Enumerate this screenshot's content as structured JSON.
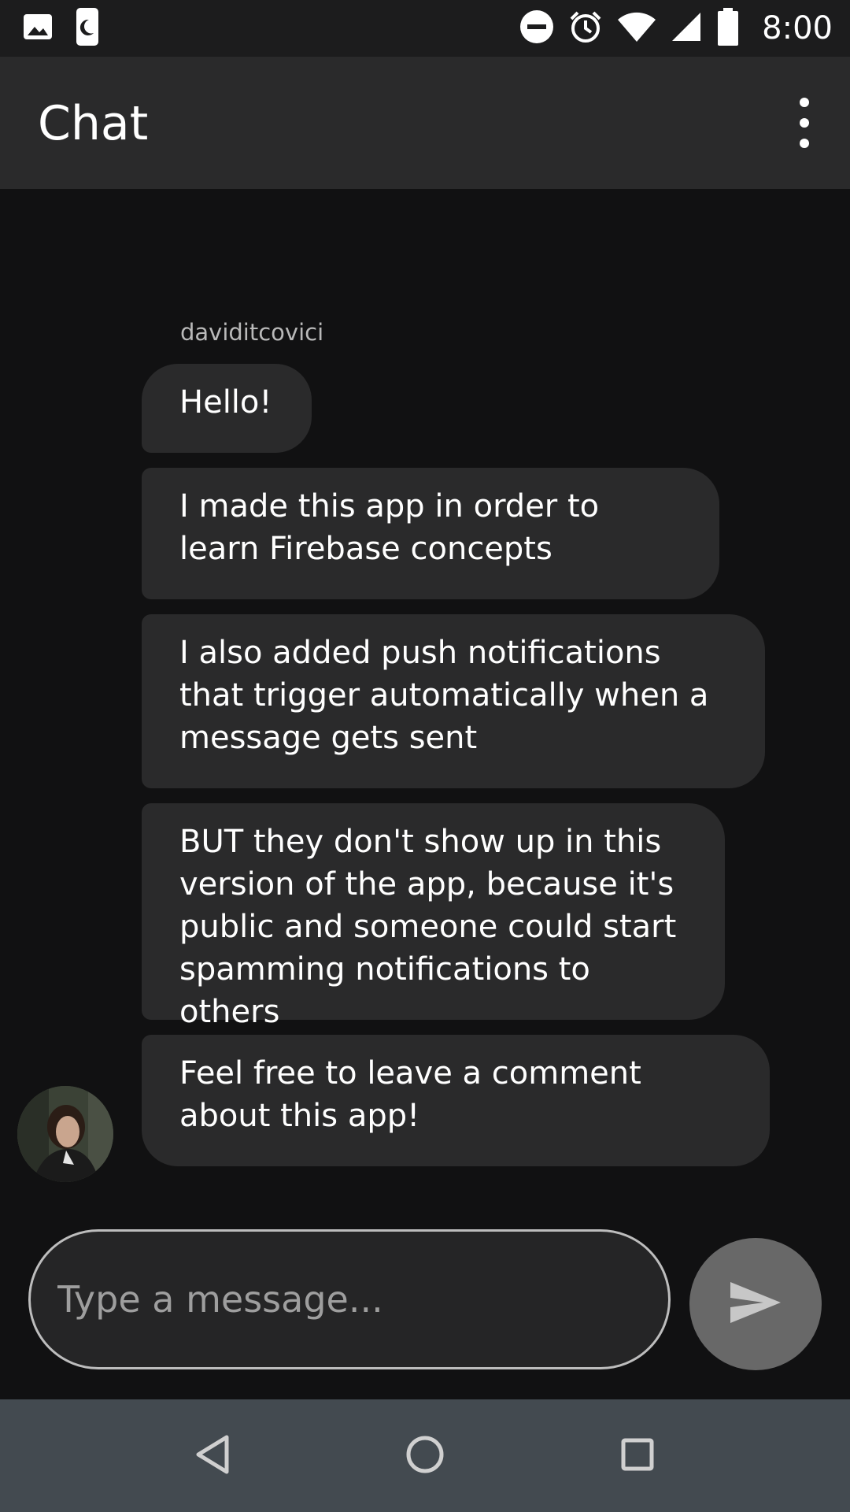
{
  "status_bar": {
    "time": "8:00",
    "icons": [
      "image-icon",
      "moon-icon",
      "do-not-disturb-icon",
      "alarm-icon",
      "wifi-icon",
      "signal-icon",
      "battery-icon"
    ]
  },
  "app_bar": {
    "title": "Chat",
    "overflow_icon": "more-vert-icon"
  },
  "conversation": {
    "sender": "daviditcovici",
    "messages": [
      {
        "text": "Hello!"
      },
      {
        "text": "I made this app in order to learn Firebase concepts"
      },
      {
        "text": "I also added push notifications that trigger automatically when a message gets sent"
      },
      {
        "text": "BUT they don't show up in this version of the app, because it's public and someone could start spamming notifications to others"
      },
      {
        "text": "Feel free to leave a comment about this app!"
      }
    ]
  },
  "composer": {
    "placeholder": "Type a message...",
    "value": "",
    "send_icon": "send-icon"
  },
  "nav_bar": {
    "buttons": [
      "back-icon",
      "home-icon",
      "recents-icon"
    ]
  },
  "colors": {
    "background": "#111112",
    "bar": "#2a2a2b",
    "bubble": "#2a2a2b",
    "send_button": "#686868",
    "nav_bar": "#434a50"
  }
}
